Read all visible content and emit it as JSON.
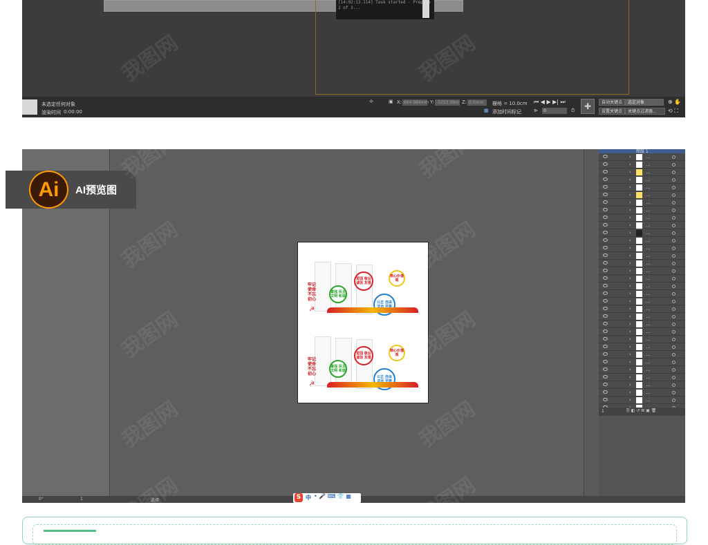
{
  "top_panel": {
    "console_lines": [
      "[14:02:13.114] Task started - Prepare",
      "2 of 3..."
    ],
    "status_message": "未选定任何对象",
    "render_time_label": "渲染时间",
    "render_time_value": "0:00:00",
    "coord_x_label": "X:",
    "coord_x_value": "664.984mm",
    "coord_y_label": "Y:",
    "coord_y_value": "-3253.09m",
    "coord_z_label": "Z:",
    "coord_z_value": "0.0mm",
    "grid_label": "栅格 = 10.0cm",
    "add_time_tag": "添加时间标记",
    "frame_value": "0",
    "auto_key": "自动关键点",
    "selected_object": "选定对象",
    "set_key": "设置关键点",
    "key_filter": "关键点过滤器..."
  },
  "badge": {
    "logo": "Ai",
    "text": "AI预览图"
  },
  "artwork": {
    "panels": [
      {
        "vertical_text": [
          "牢",
          "记",
          "使",
          "命",
          "不",
          "忘",
          "初",
          "心"
        ],
        "circles": [
          {
            "text": "富强 民主 文明 和谐",
            "color": "#2aa52a"
          },
          {
            "text": "爱国 敬业 诚信 友善",
            "color": "#d81f26"
          },
          {
            "text": "公正 自由 法治 平等",
            "color": "#1f7fd0"
          },
          {
            "text": "核心价值观",
            "color": "#f0c419"
          }
        ]
      },
      {
        "vertical_text": [
          "牢",
          "记",
          "使",
          "命",
          "不",
          "忘",
          "初",
          "心"
        ],
        "circles": [
          {
            "text": "富强 民主 文明 和谐",
            "color": "#2aa52a"
          },
          {
            "text": "爱国 敬业 诚信 友善",
            "color": "#d81f26"
          },
          {
            "text": "公正 自由 法治 平等",
            "color": "#1f7fd0"
          },
          {
            "text": "核心价值观",
            "color": "#f0c419"
          }
        ]
      }
    ]
  },
  "layers_panel": {
    "header": "图层 1",
    "rows": 34,
    "footer_count": "1"
  },
  "ai_bottom_bar": {
    "rotation": "0°",
    "artboard": "1",
    "tool": "选择"
  },
  "ime_bar": {
    "logo": "S",
    "lang": "中"
  },
  "watermark": "我图网",
  "colors": {
    "ai_orange": "#ff9a00",
    "frame_green": "#4fbf86"
  }
}
